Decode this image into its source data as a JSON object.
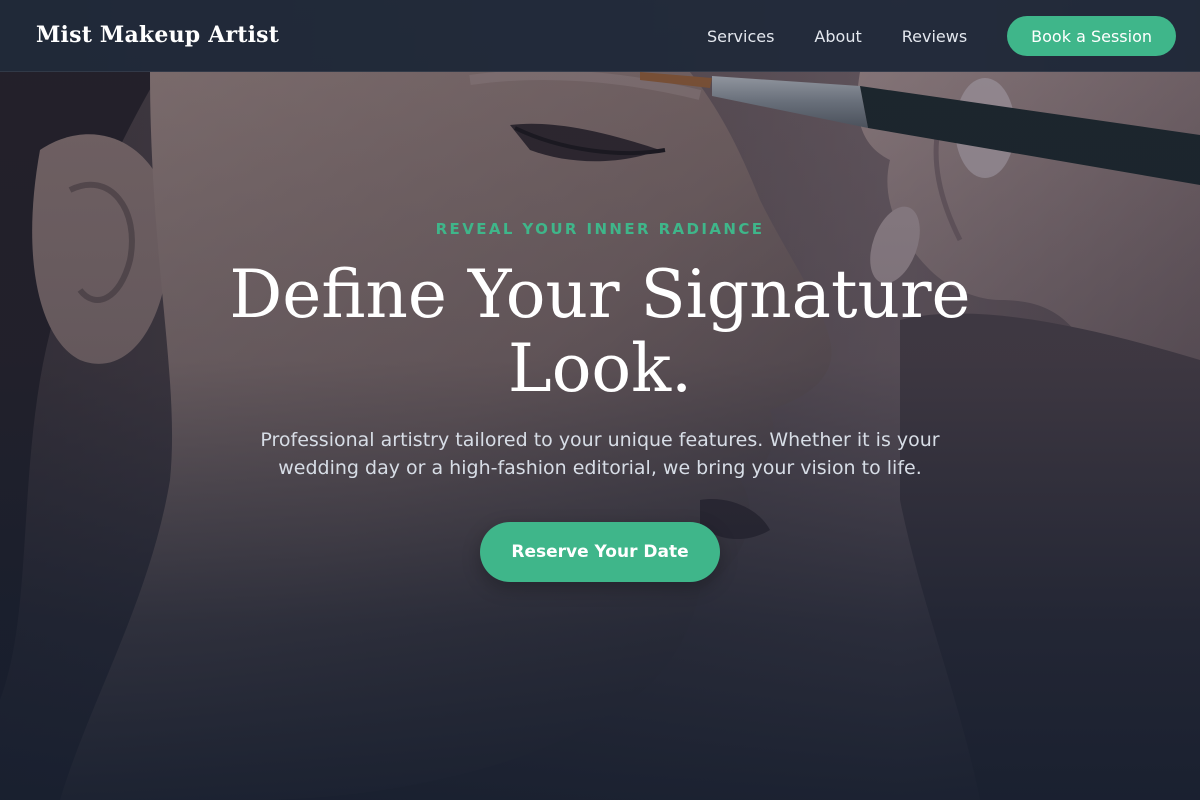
{
  "header": {
    "brand": "Mist Makeup Artist",
    "nav": [
      {
        "label": "Services"
      },
      {
        "label": "About"
      },
      {
        "label": "Reviews"
      }
    ],
    "book_label": "Book a Session"
  },
  "hero": {
    "eyebrow": "REVEAL YOUR INNER RADIANCE",
    "headline": "Define Your Signature Look.",
    "subtitle": "Professional artistry tailored to your unique features. Whether it is your wedding day or a high-fashion editorial, we bring your vision to life.",
    "cta_label": "Reserve Your Date",
    "background_image": "woman-profile-makeup-brush-photo"
  },
  "colors": {
    "accent": "#3fb68a",
    "header_bg": "#1e2838",
    "page_bg": "#1b2333"
  }
}
